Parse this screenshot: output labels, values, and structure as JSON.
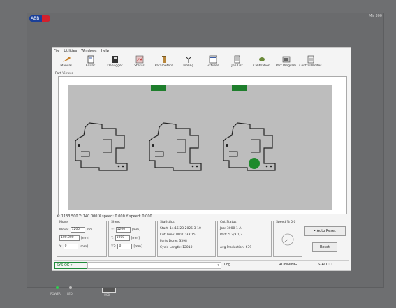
{
  "bezel": {
    "brand": "ABB",
    "right_label": "Mir 300"
  },
  "menu": [
    "File",
    "Utilities",
    "Windows",
    "Help"
  ],
  "toolbar": [
    {
      "label": "Manual",
      "icon": "wrench-icon"
    },
    {
      "label": "Editor",
      "icon": "editor-icon"
    },
    {
      "label": "Debugger",
      "icon": "debugger-icon"
    },
    {
      "label": "Status",
      "icon": "status-icon"
    },
    {
      "label": "Parameters",
      "icon": "parameters-icon"
    },
    {
      "label": "Tooling",
      "icon": "tooling-icon"
    },
    {
      "label": "Fixtures",
      "icon": "fixtures-icon"
    },
    {
      "label": "Job List",
      "icon": "joblist-icon"
    },
    {
      "label": "Calibration",
      "icon": "calibration-icon"
    },
    {
      "label": "Part Program",
      "icon": "part-program-icon"
    },
    {
      "label": "Control Modes",
      "icon": "control-modes-icon"
    }
  ],
  "view_label": "Part Viewer",
  "coords": "X: 1133.500    Y: 140.000  X speed: 0.000    Y speed: 0.000",
  "move_panel": {
    "title": "Move",
    "r1": {
      "label": "Move:",
      "value": "1200",
      "unit": "mm"
    },
    "r2": {
      "label": "100.000",
      "unit": "[mm]"
    },
    "r3": {
      "label": "Y:",
      "value": "0",
      "unit": "[mm]"
    }
  },
  "sheet_panel": {
    "title": "Sheet",
    "r1": {
      "label": "X:",
      "value": "1200",
      "unit": "[mm]"
    },
    "r2": {
      "label": "Y:",
      "value": "1000",
      "unit": "[mm]"
    },
    "r3": {
      "label": "X2:",
      "value": "0",
      "unit": "[mm]"
    }
  },
  "stats_panel": {
    "title": "Statistics",
    "lines": [
      "Start: 14:15:23  2025-3-10",
      "Cut Time: 00:01:33:15",
      "Parts Done: 3398",
      "Cycle Length: 12010"
    ]
  },
  "cut_panel": {
    "title": "Cut Status",
    "lines": [
      "Job: 3000-1-A",
      "Part: 5    2/3    1/3"
    ],
    "extra": "Avg Production: 679"
  },
  "speed_panel": {
    "title": "Speed  % 0 0"
  },
  "auto_button": "Auto Reset",
  "reset_button": "Reset",
  "status": {
    "sys": "SYS OK",
    "log": "Log",
    "running": "RUNNING",
    "mode": "S-AUTO"
  },
  "bottom": {
    "power": "POWER",
    "led2": "LED",
    "usb": "USB"
  },
  "colors": {
    "tab": "#1e7e2c",
    "dot": "#1e8a2c",
    "part_bg": "#bdbdbd"
  }
}
